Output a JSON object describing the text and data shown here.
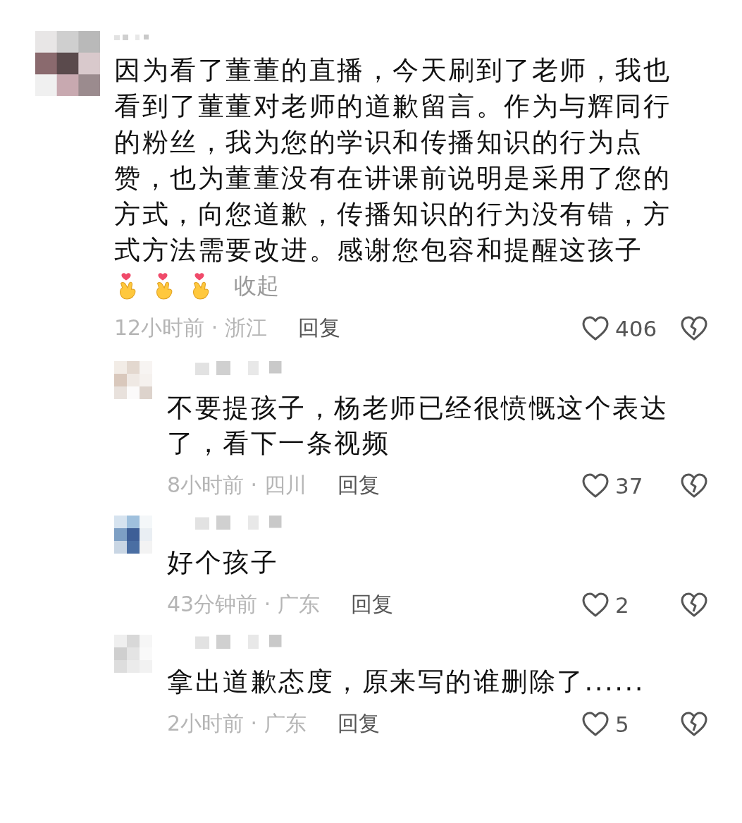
{
  "comments": [
    {
      "text": "因为看了董董的直播，今天刷到了老师，我也看到了董董对老师的道歉留言。作为与辉同行的粉丝，我为您的学识和传播知识的行为点赞，也为董董没有在讲课前说明是采用了您的方式，向您道歉，传播知识的行为没有错，方式方法需要改进。感谢您包容和提醒这孩子",
      "collapse_label": "收起",
      "time": "12小时前 · 浙江",
      "reply_label": "回复",
      "likes": "406",
      "reply": false
    },
    {
      "text": "不要提孩子，杨老师已经很愤慨这个表达了，看下一条视频",
      "time": "8小时前 · 四川",
      "reply_label": "回复",
      "likes": "37",
      "reply": true
    },
    {
      "text": "好个孩子",
      "time": "43分钟前 · 广东",
      "reply_label": "回复",
      "likes": "2",
      "reply": true
    },
    {
      "text": "拿出道歉态度，原来写的谁删除了......",
      "time": "2小时前 · 广东",
      "reply_label": "回复",
      "likes": "5",
      "reply": true
    }
  ]
}
